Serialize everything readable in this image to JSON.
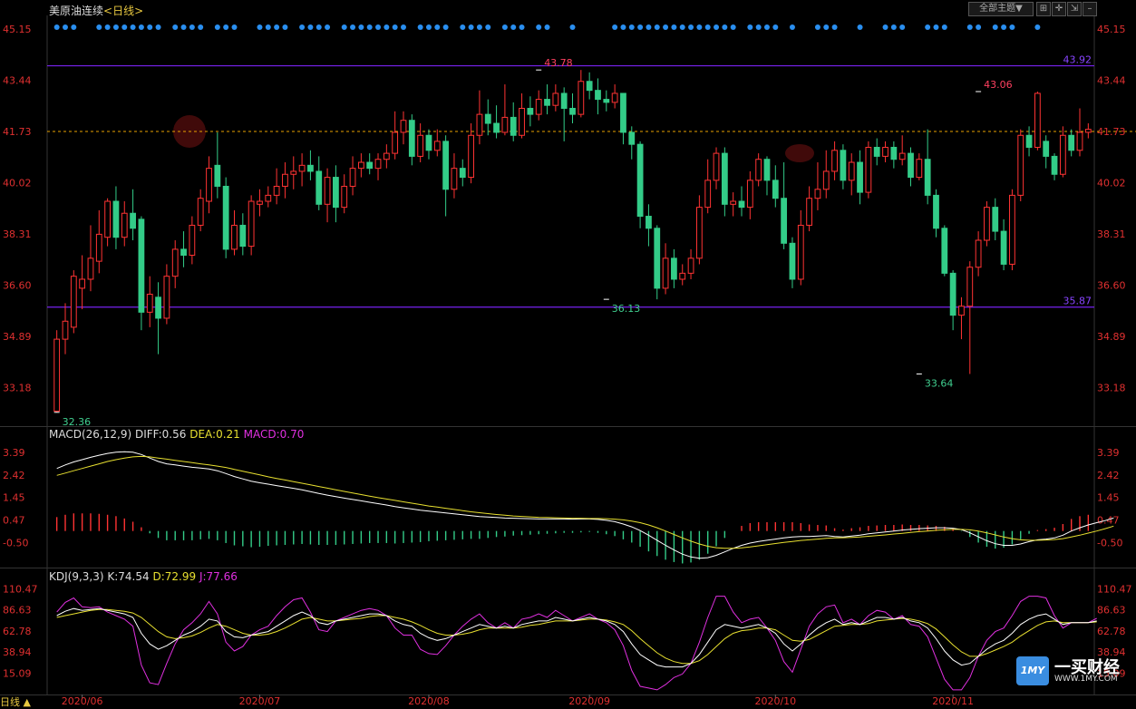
{
  "header": {
    "title": "美原油连续",
    "period": "<日线>",
    "theme_button": "全部主题▼",
    "icons": [
      "grid-icon",
      "crosshair-icon",
      "export-icon",
      "minimize-icon"
    ]
  },
  "colors": {
    "up": "#ff3333",
    "down": "#33cc88",
    "bg": "#000000",
    "grid": "#222222",
    "level_line": "#7722ee",
    "current_line": "#e8a000",
    "axis_text": "#e03030",
    "dots": "#2a8ff0"
  },
  "chart_data": {
    "type": "candlestick",
    "price_axis_ticks": [
      "45.15",
      "43.44",
      "41.73",
      "40.02",
      "38.31",
      "36.60",
      "34.89",
      "33.18"
    ],
    "price_axis_values": [
      45.15,
      43.44,
      41.73,
      40.02,
      38.31,
      36.6,
      34.89,
      33.18
    ],
    "ylim": [
      31.9,
      45.6
    ],
    "x_labels": [
      "2020/06",
      "2020/07",
      "2020/08",
      "2020/09",
      "2020/10",
      "2020/11"
    ],
    "x_label_index": [
      3,
      24,
      44,
      63,
      85,
      106
    ],
    "level_lines": [
      {
        "value": 43.92,
        "label": "43.92"
      },
      {
        "value": 35.87,
        "label": "35.87"
      }
    ],
    "current_price": 41.73,
    "annotations": [
      {
        "label": "43.78",
        "index": 57,
        "value": 43.78,
        "kind": "high"
      },
      {
        "label": "32.36",
        "index": 0,
        "value": 32.36,
        "kind": "low"
      },
      {
        "label": "36.13",
        "index": 65,
        "value": 36.13,
        "kind": "low"
      },
      {
        "label": "43.06",
        "index": 109,
        "value": 43.06,
        "kind": "high"
      },
      {
        "label": "33.64",
        "index": 102,
        "value": 33.64,
        "kind": "low"
      }
    ],
    "candles": [
      [
        32.4,
        34.8,
        32.36,
        35.1
      ],
      [
        34.8,
        35.4,
        34.3,
        36.0
      ],
      [
        35.2,
        36.9,
        35.0,
        37.1
      ],
      [
        36.5,
        36.8,
        35.8,
        37.6
      ],
      [
        36.8,
        37.5,
        36.4,
        38.6
      ],
      [
        37.4,
        38.3,
        37.0,
        39.1
      ],
      [
        38.2,
        39.4,
        37.9,
        39.5
      ],
      [
        39.4,
        38.2,
        37.8,
        39.9
      ],
      [
        38.2,
        39.0,
        37.9,
        39.4
      ],
      [
        39.0,
        38.5,
        38.1,
        39.8
      ],
      [
        38.8,
        35.7,
        35.1,
        38.9
      ],
      [
        35.7,
        36.3,
        35.2,
        36.9
      ],
      [
        36.2,
        35.5,
        34.3,
        36.7
      ],
      [
        35.5,
        36.9,
        35.3,
        37.3
      ],
      [
        36.9,
        37.8,
        36.5,
        38.1
      ],
      [
        37.8,
        37.6,
        37.2,
        38.4
      ],
      [
        37.6,
        38.6,
        37.3,
        38.9
      ],
      [
        38.6,
        39.5,
        38.4,
        39.8
      ],
      [
        39.4,
        40.5,
        39.0,
        40.9
      ],
      [
        40.6,
        39.9,
        39.5,
        41.7
      ],
      [
        39.9,
        37.8,
        37.5,
        40.2
      ],
      [
        37.8,
        38.6,
        37.6,
        39.1
      ],
      [
        38.6,
        37.9,
        37.6,
        39.0
      ],
      [
        37.9,
        39.4,
        37.6,
        39.6
      ],
      [
        39.3,
        39.4,
        38.9,
        39.8
      ],
      [
        39.4,
        39.6,
        39.2,
        39.9
      ],
      [
        39.6,
        39.9,
        39.3,
        40.5
      ],
      [
        39.9,
        40.3,
        39.5,
        40.7
      ],
      [
        40.3,
        40.4,
        39.8,
        40.9
      ],
      [
        40.4,
        40.6,
        39.9,
        41.0
      ],
      [
        40.6,
        40.4,
        40.1,
        41.1
      ],
      [
        40.4,
        39.3,
        39.1,
        40.9
      ],
      [
        39.3,
        40.2,
        38.7,
        40.5
      ],
      [
        40.2,
        39.2,
        38.7,
        40.6
      ],
      [
        39.2,
        39.9,
        39.0,
        40.3
      ],
      [
        39.9,
        40.5,
        39.6,
        40.9
      ],
      [
        40.5,
        40.7,
        40.2,
        41.0
      ],
      [
        40.7,
        40.5,
        40.3,
        41.0
      ],
      [
        40.5,
        40.8,
        40.1,
        41.0
      ],
      [
        40.8,
        41.0,
        40.5,
        41.3
      ],
      [
        41.0,
        41.7,
        40.8,
        42.4
      ],
      [
        41.7,
        42.1,
        41.3,
        42.4
      ],
      [
        42.1,
        40.9,
        40.6,
        42.3
      ],
      [
        40.9,
        41.6,
        40.7,
        42.0
      ],
      [
        41.6,
        41.1,
        40.8,
        41.8
      ],
      [
        41.1,
        41.4,
        40.9,
        41.8
      ],
      [
        41.4,
        39.8,
        38.9,
        41.6
      ],
      [
        39.8,
        40.5,
        39.5,
        41.0
      ],
      [
        40.5,
        40.2,
        39.9,
        40.8
      ],
      [
        40.2,
        41.6,
        40.0,
        42.0
      ],
      [
        41.6,
        42.3,
        41.3,
        43.1
      ],
      [
        42.3,
        42.0,
        41.6,
        42.8
      ],
      [
        42.0,
        41.7,
        41.5,
        42.6
      ],
      [
        41.7,
        42.2,
        41.6,
        43.3
      ],
      [
        42.2,
        41.6,
        41.4,
        42.7
      ],
      [
        41.6,
        42.5,
        41.5,
        43.0
      ],
      [
        42.5,
        42.3,
        41.9,
        42.9
      ],
      [
        42.3,
        42.8,
        42.1,
        43.1
      ],
      [
        42.8,
        42.6,
        42.3,
        43.3
      ],
      [
        42.6,
        43.0,
        42.4,
        43.3
      ],
      [
        43.0,
        42.5,
        41.4,
        43.2
      ],
      [
        42.5,
        42.3,
        42.0,
        43.0
      ],
      [
        42.3,
        43.4,
        42.2,
        43.78
      ],
      [
        43.4,
        43.1,
        42.8,
        43.7
      ],
      [
        43.1,
        42.8,
        42.3,
        43.5
      ],
      [
        42.8,
        42.7,
        42.4,
        43.1
      ],
      [
        42.7,
        43.0,
        42.5,
        43.3
      ],
      [
        43.0,
        41.7,
        41.3,
        43.0
      ],
      [
        41.7,
        41.3,
        40.8,
        41.9
      ],
      [
        41.3,
        38.9,
        38.5,
        41.4
      ],
      [
        38.9,
        38.5,
        37.9,
        39.3
      ],
      [
        38.5,
        36.5,
        36.13,
        38.6
      ],
      [
        36.5,
        37.5,
        36.3,
        38.0
      ],
      [
        37.5,
        36.8,
        36.5,
        37.8
      ],
      [
        36.8,
        37.0,
        36.6,
        37.3
      ],
      [
        37.0,
        37.5,
        36.8,
        37.8
      ],
      [
        37.5,
        39.2,
        37.3,
        39.6
      ],
      [
        39.2,
        40.1,
        39.0,
        40.8
      ],
      [
        40.1,
        41.0,
        39.8,
        41.2
      ],
      [
        41.0,
        39.3,
        38.9,
        41.2
      ],
      [
        39.3,
        39.4,
        38.9,
        39.7
      ],
      [
        39.4,
        39.2,
        38.9,
        39.9
      ],
      [
        39.2,
        40.1,
        38.8,
        40.4
      ],
      [
        40.1,
        40.8,
        39.9,
        41.0
      ],
      [
        40.8,
        40.1,
        39.6,
        40.9
      ],
      [
        40.1,
        39.5,
        39.2,
        40.6
      ],
      [
        39.5,
        38.0,
        37.8,
        40.7
      ],
      [
        38.0,
        36.8,
        36.5,
        38.2
      ],
      [
        36.8,
        38.6,
        36.6,
        39.1
      ],
      [
        38.6,
        39.5,
        38.4,
        39.9
      ],
      [
        39.5,
        39.8,
        39.1,
        40.7
      ],
      [
        39.8,
        40.4,
        39.5,
        41.1
      ],
      [
        40.4,
        41.1,
        40.1,
        41.4
      ],
      [
        41.1,
        40.1,
        39.8,
        41.3
      ],
      [
        40.1,
        40.7,
        39.6,
        41.0
      ],
      [
        40.7,
        39.7,
        39.3,
        41.1
      ],
      [
        39.7,
        41.2,
        39.5,
        41.4
      ],
      [
        41.2,
        40.9,
        40.6,
        41.5
      ],
      [
        40.9,
        41.2,
        40.7,
        41.4
      ],
      [
        41.2,
        40.8,
        40.5,
        41.4
      ],
      [
        40.8,
        41.0,
        40.6,
        41.6
      ],
      [
        41.0,
        40.2,
        39.9,
        41.2
      ],
      [
        40.2,
        40.8,
        40.1,
        41.0
      ],
      [
        40.8,
        39.6,
        39.3,
        41.8
      ],
      [
        39.6,
        38.5,
        38.2,
        39.8
      ],
      [
        38.5,
        37.0,
        36.9,
        38.6
      ],
      [
        37.0,
        35.6,
        35.1,
        37.1
      ],
      [
        35.6,
        35.9,
        34.8,
        36.2
      ],
      [
        35.9,
        37.2,
        33.64,
        37.4
      ],
      [
        37.2,
        38.1,
        36.9,
        38.4
      ],
      [
        38.1,
        39.2,
        37.9,
        39.4
      ],
      [
        39.2,
        38.4,
        38.1,
        39.5
      ],
      [
        38.4,
        37.3,
        37.1,
        38.8
      ],
      [
        37.3,
        39.6,
        37.1,
        39.8
      ],
      [
        39.6,
        41.6,
        39.4,
        41.8
      ],
      [
        41.6,
        41.2,
        40.9,
        41.9
      ],
      [
        41.2,
        43.0,
        41.1,
        43.06
      ],
      [
        41.4,
        40.9,
        40.5,
        41.6
      ],
      [
        40.9,
        40.3,
        40.1,
        41.0
      ],
      [
        40.3,
        41.6,
        40.2,
        41.9
      ],
      [
        41.6,
        41.1,
        40.9,
        41.8
      ],
      [
        41.1,
        41.7,
        40.9,
        42.5
      ],
      [
        41.7,
        41.8,
        41.5,
        42.0
      ]
    ],
    "macd": {
      "title": "MACD(26,12,9)",
      "diff_label": "DIFF:0.56",
      "dea_label": "DEA:0.21",
      "macd_label": "MACD:0.70",
      "axis_ticks": [
        "3.39",
        "2.42",
        "1.45",
        "0.47",
        "-0.50"
      ],
      "axis_values": [
        3.39,
        2.42,
        1.45,
        0.47,
        -0.5
      ],
      "ylim": [
        -1.5,
        3.9
      ],
      "diff": [
        2.7,
        2.85,
        2.98,
        3.08,
        3.18,
        3.27,
        3.35,
        3.4,
        3.42,
        3.4,
        3.3,
        3.15,
        3.0,
        2.9,
        2.85,
        2.8,
        2.75,
        2.72,
        2.68,
        2.6,
        2.48,
        2.35,
        2.25,
        2.15,
        2.08,
        2.02,
        1.96,
        1.9,
        1.84,
        1.78,
        1.7,
        1.62,
        1.55,
        1.48,
        1.42,
        1.36,
        1.3,
        1.24,
        1.18,
        1.12,
        1.05,
        1.0,
        0.95,
        0.9,
        0.86,
        0.82,
        0.78,
        0.74,
        0.7,
        0.66,
        0.62,
        0.6,
        0.58,
        0.56,
        0.55,
        0.54,
        0.53,
        0.52,
        0.52,
        0.52,
        0.52,
        0.51,
        0.52,
        0.52,
        0.5,
        0.46,
        0.4,
        0.3,
        0.18,
        0.02,
        -0.18,
        -0.4,
        -0.62,
        -0.82,
        -1.0,
        -1.12,
        -1.18,
        -1.15,
        -1.05,
        -0.9,
        -0.75,
        -0.62,
        -0.52,
        -0.45,
        -0.4,
        -0.35,
        -0.3,
        -0.26,
        -0.24,
        -0.24,
        -0.22,
        -0.2,
        -0.24,
        -0.26,
        -0.22,
        -0.18,
        -0.12,
        -0.08,
        -0.04,
        0.0,
        0.04,
        0.07,
        0.1,
        0.12,
        0.14,
        0.14,
        0.12,
        0.06,
        -0.08,
        -0.25,
        -0.42,
        -0.55,
        -0.62,
        -0.62,
        -0.56,
        -0.46,
        -0.38,
        -0.35,
        -0.3,
        -0.18,
        0.0,
        0.14,
        0.26,
        0.36,
        0.45,
        0.56
      ],
      "dea": [
        2.4,
        2.5,
        2.6,
        2.7,
        2.8,
        2.9,
        3.0,
        3.08,
        3.15,
        3.2,
        3.22,
        3.2,
        3.15,
        3.1,
        3.05,
        3.0,
        2.95,
        2.9,
        2.85,
        2.8,
        2.74,
        2.66,
        2.58,
        2.5,
        2.42,
        2.34,
        2.27,
        2.2,
        2.13,
        2.06,
        1.99,
        1.92,
        1.85,
        1.78,
        1.71,
        1.64,
        1.57,
        1.5,
        1.44,
        1.38,
        1.32,
        1.26,
        1.2,
        1.14,
        1.08,
        1.03,
        0.98,
        0.93,
        0.88,
        0.83,
        0.79,
        0.75,
        0.71,
        0.68,
        0.65,
        0.63,
        0.61,
        0.59,
        0.58,
        0.57,
        0.56,
        0.55,
        0.55,
        0.54,
        0.54,
        0.53,
        0.51,
        0.48,
        0.43,
        0.36,
        0.26,
        0.14,
        0.0,
        -0.15,
        -0.3,
        -0.44,
        -0.56,
        -0.66,
        -0.72,
        -0.75,
        -0.75,
        -0.73,
        -0.69,
        -0.64,
        -0.59,
        -0.54,
        -0.49,
        -0.45,
        -0.41,
        -0.38,
        -0.35,
        -0.32,
        -0.3,
        -0.29,
        -0.28,
        -0.26,
        -0.23,
        -0.2,
        -0.17,
        -0.13,
        -0.1,
        -0.06,
        -0.03,
        0.0,
        0.03,
        0.05,
        0.07,
        0.07,
        0.05,
        0.0,
        -0.08,
        -0.17,
        -0.26,
        -0.33,
        -0.38,
        -0.4,
        -0.4,
        -0.39,
        -0.37,
        -0.33,
        -0.26,
        -0.18,
        -0.09,
        0.0,
        0.1,
        0.21
      ]
    },
    "kdj": {
      "title": "KDJ(9,3,3)",
      "k_label": "K:74.54",
      "d_label": "D:72.99",
      "j_label": "J:77.66",
      "axis_ticks": [
        "110.47",
        "86.63",
        "62.78",
        "38.94",
        "15.09"
      ],
      "axis_values": [
        110.47,
        86.63,
        62.78,
        38.94,
        15.09
      ],
      "ylim": [
        0,
        118
      ],
      "k": [
        80,
        85,
        88,
        86,
        87,
        88,
        86,
        84,
        82,
        78,
        60,
        48,
        42,
        46,
        52,
        58,
        62,
        68,
        76,
        74,
        62,
        56,
        55,
        58,
        60,
        62,
        68,
        74,
        80,
        84,
        80,
        72,
        70,
        74,
        76,
        78,
        80,
        82,
        82,
        80,
        74,
        70,
        68,
        60,
        55,
        52,
        54,
        58,
        62,
        66,
        70,
        68,
        66,
        68,
        66,
        70,
        72,
        74,
        74,
        78,
        76,
        74,
        76,
        78,
        76,
        74,
        70,
        62,
        48,
        36,
        30,
        24,
        22,
        22,
        22,
        26,
        36,
        50,
        64,
        70,
        68,
        66,
        68,
        70,
        66,
        60,
        48,
        40,
        48,
        58,
        66,
        72,
        76,
        70,
        72,
        70,
        74,
        78,
        78,
        76,
        78,
        74,
        72,
        66,
        54,
        40,
        30,
        24,
        26,
        34,
        42,
        48,
        52,
        60,
        70,
        76,
        80,
        82,
        76,
        70,
        72,
        72,
        72,
        74
      ],
      "d": [
        78,
        80,
        82,
        84,
        86,
        87,
        87,
        86,
        85,
        83,
        78,
        70,
        62,
        56,
        54,
        55,
        57,
        61,
        66,
        70,
        68,
        64,
        60,
        58,
        58,
        59,
        62,
        66,
        71,
        76,
        78,
        76,
        74,
        74,
        75,
        76,
        77,
        79,
        80,
        80,
        78,
        76,
        73,
        69,
        64,
        60,
        58,
        58,
        59,
        61,
        64,
        66,
        66,
        66,
        66,
        67,
        69,
        70,
        72,
        74,
        74,
        74,
        75,
        76,
        76,
        75,
        73,
        70,
        63,
        54,
        46,
        38,
        32,
        28,
        26,
        26,
        29,
        36,
        45,
        54,
        60,
        63,
        64,
        66,
        66,
        64,
        58,
        52,
        51,
        53,
        58,
        63,
        68,
        69,
        70,
        70,
        71,
        74,
        75,
        76,
        77,
        76,
        74,
        71,
        65,
        56,
        47,
        39,
        34,
        34,
        37,
        41,
        45,
        50,
        57,
        63,
        69,
        73,
        74,
        72,
        72,
        72,
        72,
        73
      ],
      "j": [
        84,
        95,
        100,
        90,
        89,
        90,
        84,
        80,
        76,
        68,
        24,
        4,
        2,
        26,
        48,
        64,
        72,
        82,
        96,
        82,
        50,
        40,
        45,
        58,
        64,
        68,
        80,
        90,
        98,
        100,
        84,
        64,
        62,
        74,
        78,
        82,
        86,
        88,
        86,
        80,
        66,
        58,
        58,
        42,
        37,
        36,
        46,
        58,
        68,
        76,
        82,
        72,
        66,
        72,
        66,
        76,
        78,
        82,
        78,
        86,
        80,
        74,
        78,
        82,
        76,
        72,
        64,
        46,
        18,
        0,
        -2,
        -4,
        2,
        10,
        14,
        26,
        50,
        78,
        102,
        102,
        84,
        72,
        76,
        78,
        66,
        52,
        28,
        16,
        42,
        68,
        82,
        90,
        92,
        72,
        76,
        70,
        80,
        86,
        84,
        76,
        80,
        70,
        68,
        56,
        32,
        8,
        -4,
        -6,
        10,
        34,
        52,
        62,
        66,
        80,
        96,
        102,
        102,
        100,
        80,
        66,
        72,
        72,
        72,
        77
      ]
    }
  },
  "footer": {
    "period_button": "日线 ▲"
  },
  "watermark": {
    "logo_text": "1MY",
    "name": "一买财经",
    "url": "WWW.1MY.COM"
  }
}
